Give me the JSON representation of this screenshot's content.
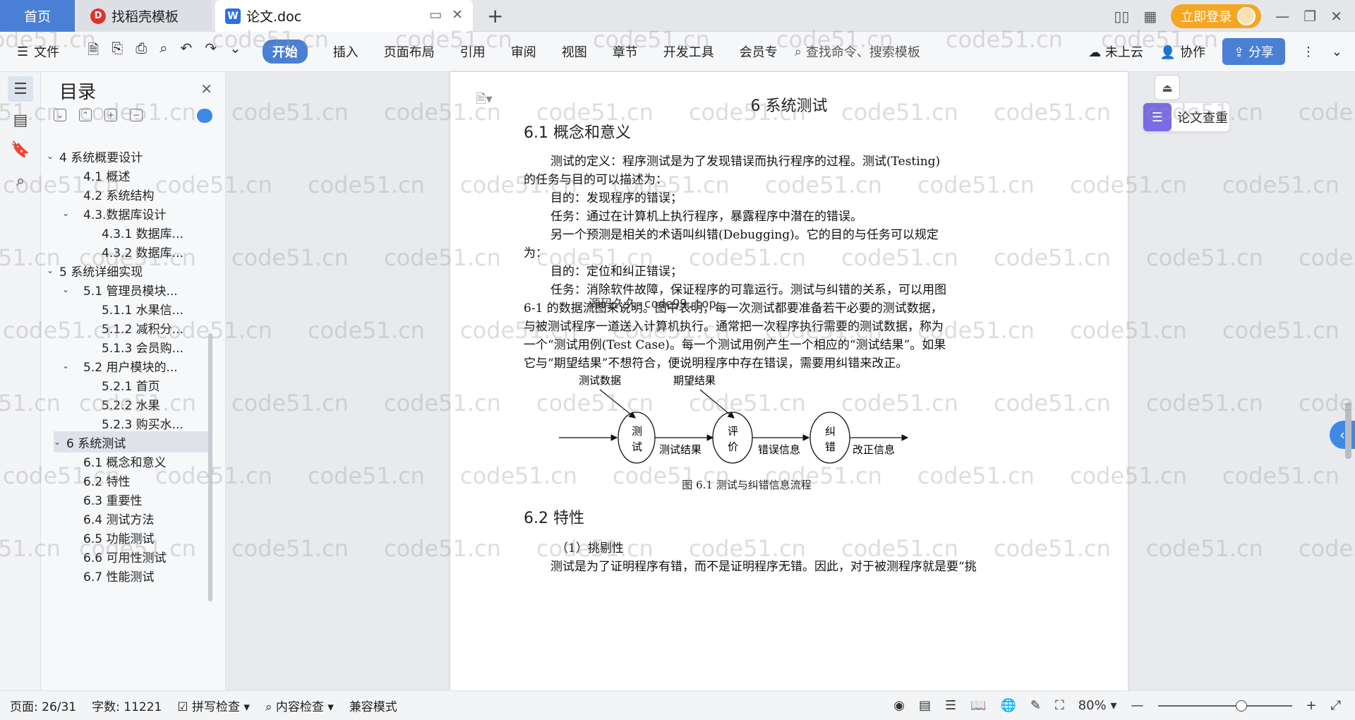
{
  "tabs": {
    "home": "首页",
    "daoke": "找稻壳模板",
    "doc": "论文.doc"
  },
  "title_right": {
    "login": "立即登录"
  },
  "ribbon": {
    "file": "文件",
    "menus": [
      "开始",
      "插入",
      "页面布局",
      "引用",
      "审阅",
      "视图",
      "章节",
      "开发工具",
      "会员专"
    ],
    "search_placeholder": "查找命令、搜索模板",
    "cloud": "未上云",
    "collab": "协作",
    "share": "分享"
  },
  "toc": {
    "title": "目录",
    "items": [
      {
        "label": "4 系统概要设计",
        "level": 1,
        "collapsed": false
      },
      {
        "label": "4.1 概述",
        "level": 2
      },
      {
        "label": "4.2 系统结构",
        "level": 2
      },
      {
        "label": "4.3.数据库设计",
        "level": 2,
        "collapsed": false
      },
      {
        "label": "4.3.1 数据库...",
        "level": 3
      },
      {
        "label": "4.3.2 数据库...",
        "level": 3
      },
      {
        "label": "5 系统详细实现",
        "level": 1,
        "collapsed": false
      },
      {
        "label": "5.1 管理员模块...",
        "level": 2,
        "collapsed": false
      },
      {
        "label": "5.1.1 水果信...",
        "level": 3
      },
      {
        "label": "5.1.2 减积分...",
        "level": 3
      },
      {
        "label": "5.1.3 会员购...",
        "level": 3
      },
      {
        "label": "5.2 用户模块的...",
        "level": 2,
        "collapsed": false
      },
      {
        "label": "5.2.1 首页",
        "level": 3
      },
      {
        "label": "5.2.2 水果",
        "level": 3
      },
      {
        "label": "5.2.3 购买水...",
        "level": 3
      },
      {
        "label": "6 系统测试",
        "level": 1,
        "collapsed": false,
        "selected": true
      },
      {
        "label": "6.1 概念和意义",
        "level": 2
      },
      {
        "label": "6.2 特性",
        "level": 2
      },
      {
        "label": "6.3 重要性",
        "level": 2
      },
      {
        "label": "6.4 测试方法",
        "level": 2
      },
      {
        "label": "6.5 功能测试",
        "level": 2
      },
      {
        "label": "6.6 可用性测试",
        "level": 2
      },
      {
        "label": "6.7 性能测试",
        "level": 2
      }
    ]
  },
  "document": {
    "chapter": "6 系统测试",
    "sec1": "6.1 概念和意义",
    "paras": [
      "测试的定义：程序测试是为了发现错误而执行程序的过程。测试(Testing)的任务与目的可以描述为：",
      "目的：发现程序的错误；",
      "任务：通过在计算机上执行程序，暴露程序中潜在的错误。",
      "另一个预测是相关的术语叫纠错(Debugging)。它的目的与任务可以规定为：",
      "目的：定位和纠正错误；",
      "任务：消除软件故障，保证程序的可靠运行。测试与纠错的关系，可以用图 6-1 的数据流图来说明。图中表明，每一次测试都要准备若干必要的测试数据，与被测试程序一道送入计算机执行。通常把一次程序执行需要的测试数据，称为一个“测试用例(Test Case)。每一个测试用例产生一个相应的“测试结果”。如果它与“期望结果”不想符合，便说明程序中存在错误，需要用纠错来改正。"
    ],
    "overlay_text": "源码久久-code99.top",
    "figure": {
      "input1": "测试数据",
      "input2": "期望结果",
      "node1": [
        "测",
        "试"
      ],
      "node2": [
        "评",
        "价"
      ],
      "node3": [
        "纠",
        "错"
      ],
      "edge1": "测试结果",
      "edge2": "错误信息",
      "edge3": "改正信息"
    },
    "caption": "图 6.1 测试与纠错信息流程",
    "sec2": "6.2 特性",
    "item1": "（1）挑剔性",
    "cut_line": "测试是为了证明程序有错，而不是证明程序无错。因此，对于被测程序就是要“挑"
  },
  "right_panel": {
    "check": "论文查重"
  },
  "status": {
    "page": "页面: 26/31",
    "words": "字数: 11221",
    "spell": "拼写检查",
    "content": "内容检查",
    "compat": "兼容模式",
    "zoom": "80%"
  },
  "watermark": "code51.cn"
}
